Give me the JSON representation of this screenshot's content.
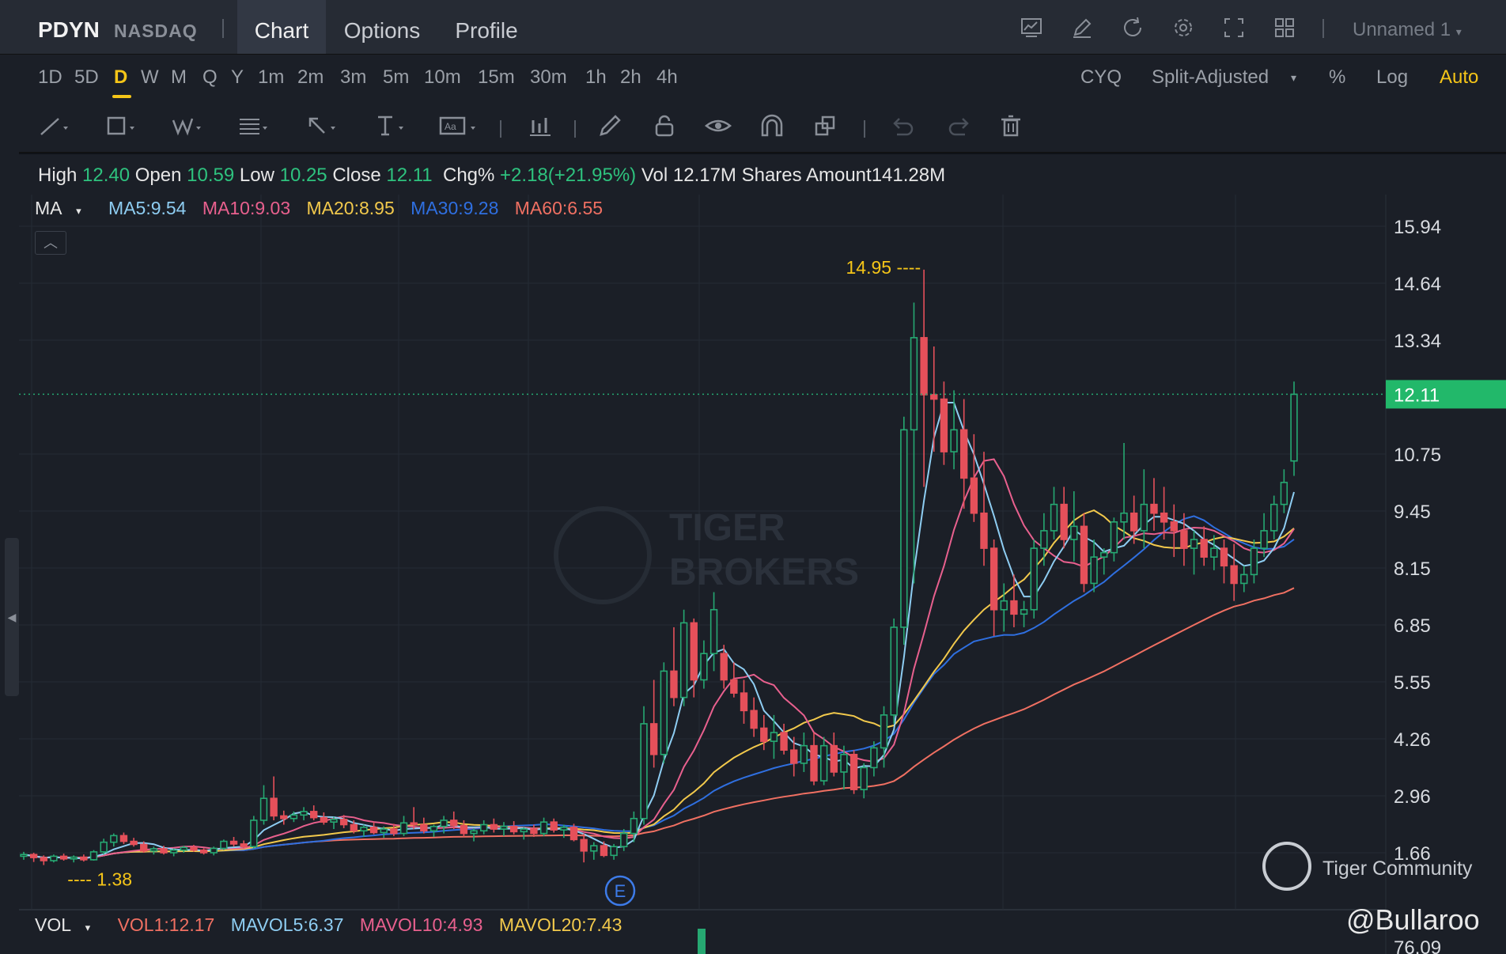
{
  "header": {
    "ticker": "PDYN",
    "exchange": "NASDAQ",
    "tabs": [
      "Chart",
      "Options",
      "Profile"
    ],
    "active_tab": "Chart",
    "toolbar_icons": [
      "chart-settings-icon",
      "edit-icon",
      "refresh-icon",
      "gear-icon",
      "fullscreen-icon",
      "layout-grid-icon"
    ],
    "layout_name": "Unnamed 1"
  },
  "periods": {
    "items": [
      "1D",
      "5D",
      "D",
      "W",
      "M",
      "Q",
      "Y",
      "1m",
      "2m",
      "3m",
      "5m",
      "10m",
      "15m",
      "30m",
      "1h",
      "2h",
      "4h"
    ],
    "active": "D"
  },
  "options": {
    "cyq": "CYQ",
    "adjust": "Split-Adjusted",
    "percent": "%",
    "log": "Log",
    "auto": "Auto"
  },
  "ohlc": {
    "high_label": "High",
    "high": "12.40",
    "open_label": "Open",
    "open": "10.59",
    "low_label": "Low",
    "low": "10.25",
    "close_label": "Close",
    "close": "12.11",
    "chg_label": "Chg%",
    "chg": "+2.18(+21.95%)",
    "vol_label": "Vol",
    "vol": "12.17M Shares",
    "amount_label": "Amount",
    "amount": "141.28M"
  },
  "indicators": {
    "ma_label": "MA",
    "ma5": "MA5:9.54",
    "ma10": "MA10:9.03",
    "ma20": "MA20:8.95",
    "ma30": "MA30:9.28",
    "ma60": "MA60:6.55",
    "vol_label": "VOL",
    "vol1": "VOL1:12.17",
    "mavol5": "MAVOL5:6.37",
    "mavol10": "MAVOL10:4.93",
    "mavol20": "MAVOL20:7.43"
  },
  "colors": {
    "up": "#26a872",
    "down": "#e5505a",
    "ma5": "#8ecdf2",
    "ma10": "#e8608e",
    "ma20": "#f2c94c",
    "ma30": "#2f6fe0",
    "ma60": "#f07062",
    "accent": "#f5c518"
  },
  "watermark": {
    "line1": "TIGER",
    "line2": "BROKERS"
  },
  "community": "Tiger Community",
  "user_handle": "@Bullaroo",
  "chart_data": {
    "type": "candlestick",
    "yticks": [
      "15.94",
      "14.64",
      "13.34",
      "12.11",
      "10.75",
      "9.45",
      "8.15",
      "6.85",
      "5.55",
      "4.26",
      "2.96",
      "1.66",
      "76.09"
    ],
    "ylim": [
      1.38,
      15.94
    ],
    "last_price": "12.11",
    "max_label": "14.95 ----",
    "min_label": "---- 1.38",
    "event_marker": "E",
    "candles": [
      [
        1.58,
        1.68,
        1.5,
        1.62
      ],
      [
        1.62,
        1.66,
        1.45,
        1.55
      ],
      [
        1.55,
        1.6,
        1.38,
        1.48
      ],
      [
        1.48,
        1.62,
        1.44,
        1.58
      ],
      [
        1.58,
        1.64,
        1.48,
        1.52
      ],
      [
        1.52,
        1.6,
        1.44,
        1.56
      ],
      [
        1.56,
        1.62,
        1.46,
        1.5
      ],
      [
        1.5,
        1.72,
        1.48,
        1.68
      ],
      [
        1.68,
        1.98,
        1.62,
        1.9
      ],
      [
        1.9,
        2.1,
        1.8,
        2.05
      ],
      [
        2.05,
        2.12,
        1.86,
        1.92
      ],
      [
        1.92,
        2.0,
        1.8,
        1.85
      ],
      [
        1.85,
        1.92,
        1.66,
        1.7
      ],
      [
        1.7,
        1.8,
        1.62,
        1.75
      ],
      [
        1.75,
        1.82,
        1.62,
        1.66
      ],
      [
        1.66,
        1.76,
        1.58,
        1.72
      ],
      [
        1.72,
        1.82,
        1.66,
        1.78
      ],
      [
        1.78,
        1.84,
        1.68,
        1.72
      ],
      [
        1.72,
        1.76,
        1.62,
        1.66
      ],
      [
        1.66,
        1.8,
        1.6,
        1.76
      ],
      [
        1.76,
        1.96,
        1.72,
        1.92
      ],
      [
        1.92,
        2.02,
        1.8,
        1.86
      ],
      [
        1.86,
        1.94,
        1.76,
        1.8
      ],
      [
        1.8,
        2.5,
        1.76,
        2.4
      ],
      [
        2.4,
        3.2,
        2.3,
        2.9
      ],
      [
        2.9,
        3.4,
        2.4,
        2.5
      ],
      [
        2.5,
        2.62,
        2.3,
        2.44
      ],
      [
        2.44,
        2.6,
        2.36,
        2.52
      ],
      [
        2.52,
        2.7,
        2.4,
        2.6
      ],
      [
        2.6,
        2.74,
        2.4,
        2.46
      ],
      [
        2.46,
        2.58,
        2.3,
        2.36
      ],
      [
        2.36,
        2.48,
        2.2,
        2.42
      ],
      [
        2.42,
        2.52,
        2.22,
        2.3
      ],
      [
        2.3,
        2.4,
        2.1,
        2.16
      ],
      [
        2.16,
        2.3,
        2.02,
        2.24
      ],
      [
        2.24,
        2.36,
        2.08,
        2.12
      ],
      [
        2.12,
        2.26,
        2.0,
        2.2
      ],
      [
        2.2,
        2.32,
        2.04,
        2.1
      ],
      [
        2.1,
        2.5,
        2.04,
        2.34
      ],
      [
        2.34,
        2.7,
        2.2,
        2.3
      ],
      [
        2.3,
        2.46,
        2.1,
        2.16
      ],
      [
        2.16,
        2.3,
        2.02,
        2.26
      ],
      [
        2.26,
        2.5,
        2.1,
        2.4
      ],
      [
        2.4,
        2.6,
        2.2,
        2.28
      ],
      [
        2.28,
        2.4,
        2.02,
        2.1
      ],
      [
        2.1,
        2.22,
        1.92,
        2.16
      ],
      [
        2.16,
        2.4,
        2.08,
        2.3
      ],
      [
        2.3,
        2.44,
        2.12,
        2.2
      ],
      [
        2.2,
        2.36,
        2.04,
        2.26
      ],
      [
        2.26,
        2.38,
        2.08,
        2.14
      ],
      [
        2.14,
        2.24,
        1.96,
        2.2
      ],
      [
        2.2,
        2.3,
        2.02,
        2.1
      ],
      [
        2.1,
        2.46,
        2.04,
        2.36
      ],
      [
        2.36,
        2.44,
        2.12,
        2.18
      ],
      [
        2.18,
        2.3,
        2.0,
        2.24
      ],
      [
        2.24,
        2.32,
        1.92,
        1.96
      ],
      [
        1.96,
        2.1,
        1.44,
        1.7
      ],
      [
        1.7,
        1.9,
        1.5,
        1.82
      ],
      [
        1.82,
        1.92,
        1.56,
        1.6
      ],
      [
        1.6,
        1.86,
        1.5,
        1.8
      ],
      [
        1.8,
        2.2,
        1.7,
        2.1
      ],
      [
        2.1,
        2.6,
        1.9,
        2.44
      ],
      [
        2.44,
        5.0,
        2.3,
        4.6
      ],
      [
        4.6,
        5.6,
        3.6,
        3.9
      ],
      [
        3.9,
        6.0,
        3.7,
        5.8
      ],
      [
        5.8,
        6.8,
        5.0,
        5.2
      ],
      [
        5.2,
        7.2,
        5.0,
        6.9
      ],
      [
        6.9,
        7.0,
        5.2,
        5.6
      ],
      [
        5.6,
        6.5,
        5.4,
        6.2
      ],
      [
        6.2,
        7.6,
        5.8,
        7.2
      ],
      [
        6.2,
        6.4,
        5.4,
        5.6
      ],
      [
        5.6,
        6.0,
        5.2,
        5.3
      ],
      [
        5.3,
        5.6,
        4.6,
        4.9
      ],
      [
        4.9,
        5.2,
        4.3,
        4.5
      ],
      [
        4.5,
        4.8,
        4.0,
        4.2
      ],
      [
        4.2,
        4.8,
        3.8,
        4.4
      ],
      [
        4.4,
        4.6,
        3.9,
        4.0
      ],
      [
        4.0,
        4.3,
        3.4,
        3.7
      ],
      [
        3.7,
        4.4,
        3.5,
        4.1
      ],
      [
        4.1,
        4.4,
        3.2,
        3.3
      ],
      [
        3.3,
        4.3,
        3.2,
        4.1
      ],
      [
        4.1,
        4.4,
        3.4,
        3.5
      ],
      [
        3.5,
        4.1,
        3.1,
        3.9
      ],
      [
        3.9,
        4.0,
        3.0,
        3.1
      ],
      [
        3.1,
        3.7,
        2.9,
        3.6
      ],
      [
        3.6,
        4.2,
        3.4,
        4.05
      ],
      [
        4.05,
        5.0,
        3.6,
        4.8
      ],
      [
        4.8,
        7.0,
        4.6,
        6.8
      ],
      [
        6.8,
        11.6,
        6.4,
        11.3
      ],
      [
        11.3,
        14.2,
        7.8,
        13.4
      ],
      [
        13.4,
        14.95,
        10.0,
        12.1
      ],
      [
        12.1,
        13.2,
        10.8,
        12.0
      ],
      [
        12.0,
        12.4,
        10.5,
        10.8
      ],
      [
        10.8,
        12.2,
        10.4,
        11.3
      ],
      [
        11.3,
        12.0,
        9.5,
        10.2
      ],
      [
        10.2,
        11.2,
        9.2,
        9.4
      ],
      [
        9.4,
        10.8,
        8.2,
        8.6
      ],
      [
        8.6,
        8.8,
        6.6,
        7.2
      ],
      [
        7.2,
        7.8,
        6.7,
        7.4
      ],
      [
        7.4,
        8.0,
        6.8,
        7.1
      ],
      [
        7.1,
        7.4,
        6.8,
        7.2
      ],
      [
        7.2,
        8.8,
        7.0,
        8.6
      ],
      [
        8.6,
        9.4,
        8.2,
        9.0
      ],
      [
        9.0,
        10.0,
        8.8,
        9.6
      ],
      [
        9.6,
        10.0,
        8.6,
        8.8
      ],
      [
        8.8,
        9.9,
        8.3,
        9.1
      ],
      [
        9.1,
        9.4,
        7.6,
        7.8
      ],
      [
        7.8,
        8.8,
        7.6,
        8.4
      ],
      [
        8.4,
        8.6,
        8.0,
        8.5
      ],
      [
        8.5,
        9.3,
        8.3,
        9.2
      ],
      [
        9.2,
        11.0,
        8.8,
        9.4
      ],
      [
        9.4,
        9.8,
        8.7,
        9.0
      ],
      [
        9.0,
        10.4,
        8.6,
        9.6
      ],
      [
        9.6,
        10.2,
        9.0,
        9.4
      ],
      [
        9.4,
        10.0,
        8.8,
        9.2
      ],
      [
        9.2,
        9.6,
        8.4,
        9.0
      ],
      [
        9.0,
        9.4,
        8.2,
        8.6
      ],
      [
        8.6,
        9.0,
        8.0,
        8.8
      ],
      [
        8.8,
        9.1,
        8.2,
        8.4
      ],
      [
        8.4,
        8.9,
        8.1,
        8.6
      ],
      [
        8.6,
        8.8,
        7.8,
        8.2
      ],
      [
        8.2,
        8.7,
        7.4,
        7.8
      ],
      [
        7.8,
        8.2,
        7.6,
        8.0
      ],
      [
        8.0,
        8.8,
        7.8,
        8.6
      ],
      [
        8.6,
        9.4,
        8.4,
        9.0
      ],
      [
        9.0,
        9.8,
        8.8,
        9.6
      ],
      [
        9.6,
        10.4,
        9.4,
        10.1
      ],
      [
        10.59,
        12.4,
        10.25,
        12.11
      ]
    ],
    "volume": {
      "last_bar_label": "VOL1:12.17"
    }
  }
}
